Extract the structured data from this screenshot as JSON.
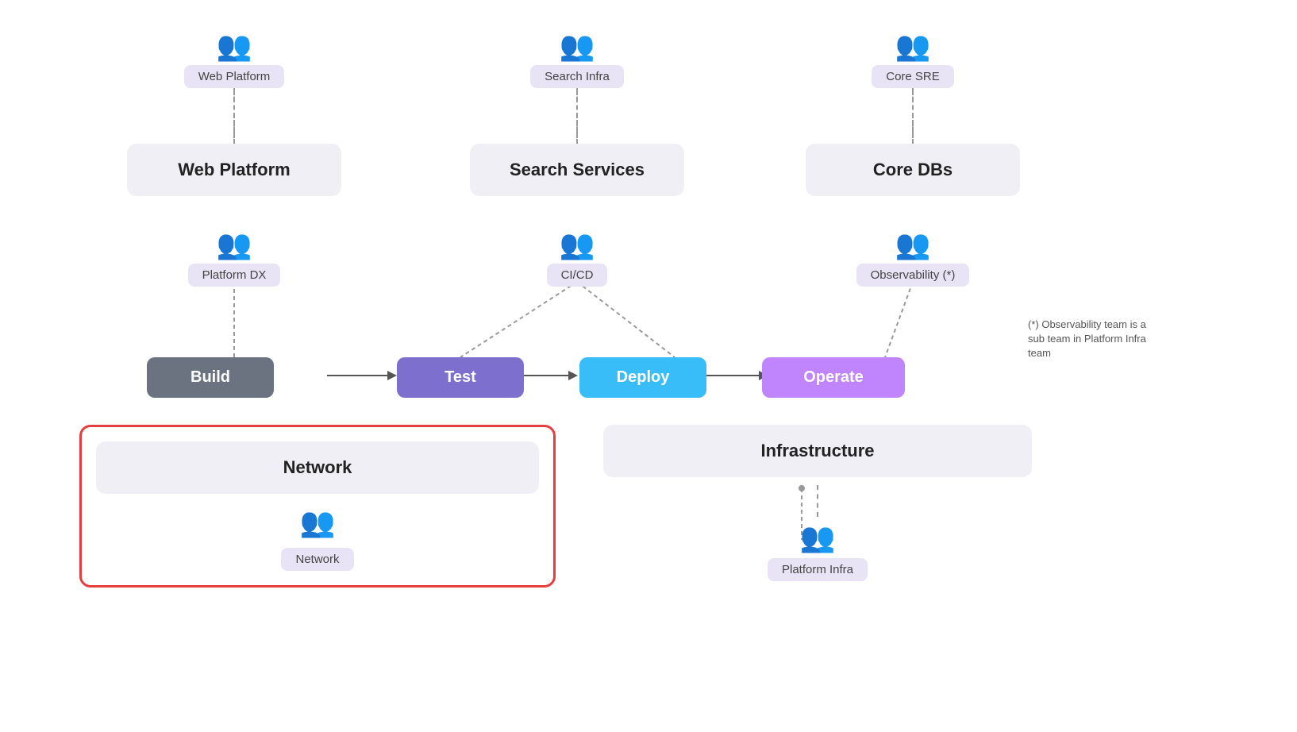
{
  "teams": {
    "row1": [
      {
        "id": "web-platform-team",
        "label": "Web Platform",
        "service": "Web Platform"
      },
      {
        "id": "search-infra-team",
        "label": "Search Infra",
        "service": "Search Services"
      },
      {
        "id": "core-sre-team",
        "label": "Core SRE",
        "service": "Core DBs"
      }
    ],
    "row2": [
      {
        "id": "platform-dx-team",
        "label": "Platform DX"
      },
      {
        "id": "cicd-team",
        "label": "CI/CD"
      },
      {
        "id": "observability-team",
        "label": "Observability (*)"
      }
    ]
  },
  "pipeline": {
    "stages": [
      {
        "id": "build",
        "label": "Build",
        "class": "stage-build"
      },
      {
        "id": "test",
        "label": "Test",
        "class": "stage-test"
      },
      {
        "id": "deploy",
        "label": "Deploy",
        "class": "stage-deploy"
      },
      {
        "id": "operate",
        "label": "Operate",
        "class": "stage-operate"
      }
    ]
  },
  "bottom": {
    "network": {
      "title": "Network",
      "team_label": "Network",
      "highlighted": true
    },
    "infrastructure": {
      "title": "Infrastructure",
      "team_label": "Platform Infra",
      "highlighted": false
    }
  },
  "note": "(*) Observability team is a sub team in Platform Infra team",
  "icons": {
    "people": "👥"
  }
}
